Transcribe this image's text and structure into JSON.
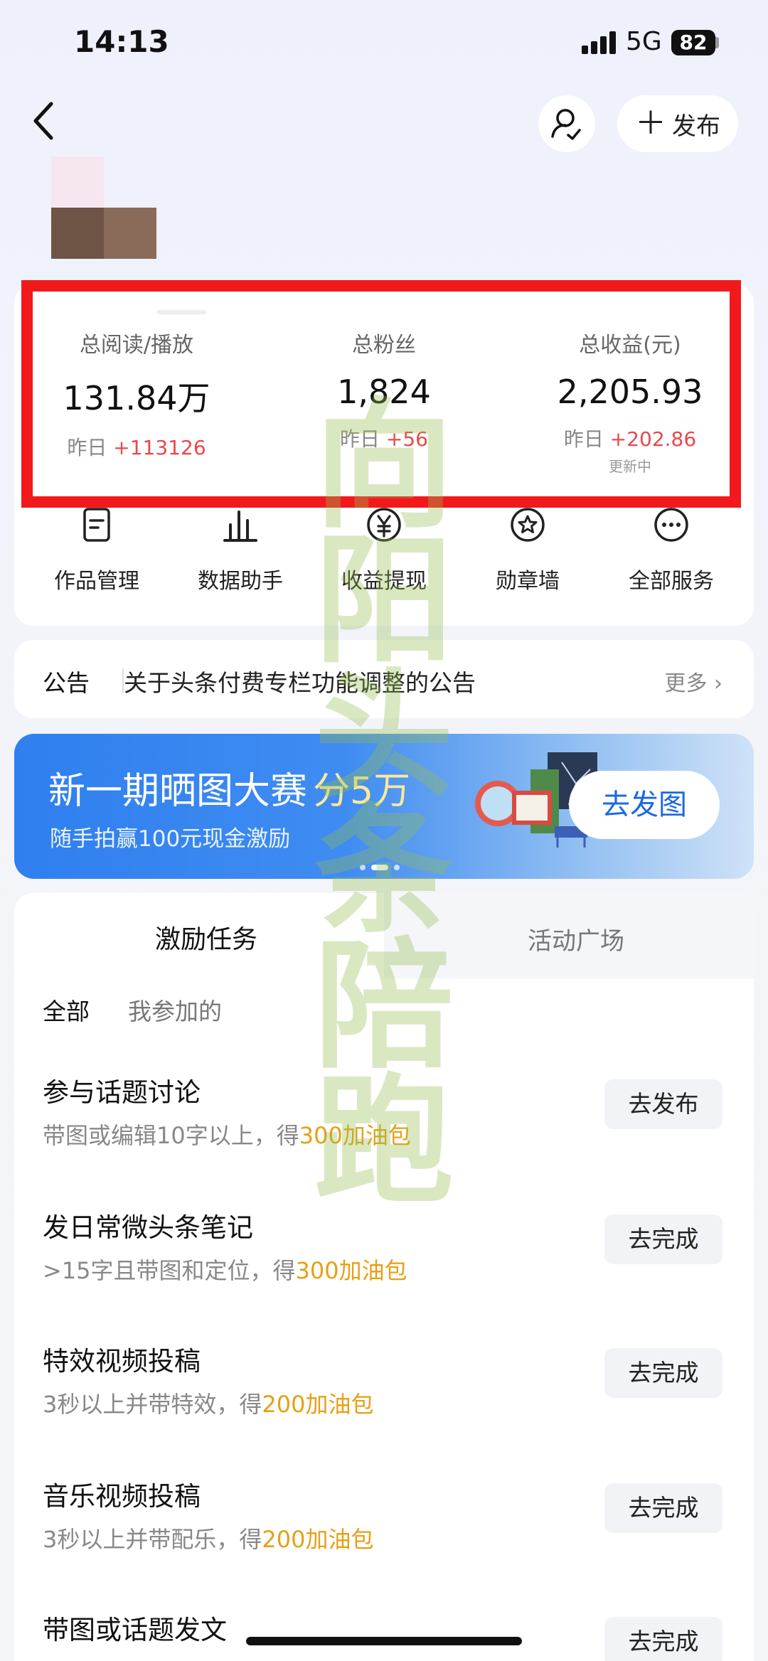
{
  "status_bar": {
    "time": "14:13",
    "network": "5G",
    "battery": "82"
  },
  "nav": {
    "publish_label": "发布"
  },
  "stats": [
    {
      "label": "总阅读/播放",
      "value": "131.84万",
      "delta_prefix": "昨日",
      "delta": "+113126",
      "sub": ""
    },
    {
      "label": "总粉丝",
      "value": "1,824",
      "delta_prefix": "昨日",
      "delta": "+56",
      "sub": ""
    },
    {
      "label": "总收益(元)",
      "value": "2,205.93",
      "delta_prefix": "昨日",
      "delta": "+202.86",
      "sub": "更新中"
    }
  ],
  "services": [
    {
      "label": "作品管理",
      "icon": "document-icon"
    },
    {
      "label": "数据助手",
      "icon": "bar-chart-icon"
    },
    {
      "label": "收益提现",
      "icon": "yen-icon"
    },
    {
      "label": "勋章墙",
      "icon": "medal-icon"
    },
    {
      "label": "全部服务",
      "icon": "more-icon"
    }
  ],
  "notice": {
    "tag": "公告",
    "title": "关于头条付费专栏功能调整的公告",
    "more": "更多 ›"
  },
  "banner": {
    "title": "新一期晒图大赛",
    "title_highlight": "分5万",
    "subtitle": "随手拍赢100元现金激励",
    "cta": "去发图"
  },
  "tasks_section": {
    "tab_active": "激励任务",
    "tab_inactive": "活动广场",
    "filter_all": "全部",
    "filter_mine": "我参加的",
    "items": [
      {
        "title": "参与话题讨论",
        "desc": "带图或编辑10字以上，得",
        "reward": "300加油包",
        "button": "去发布"
      },
      {
        "title": "发日常微头条笔记",
        "desc": ">15字且带图和定位，得",
        "reward": "300加油包",
        "button": "去完成"
      },
      {
        "title": "特效视频投稿",
        "desc": "3秒以上并带特效，得",
        "reward": "200加油包",
        "button": "去完成"
      },
      {
        "title": "音乐视频投稿",
        "desc": "3秒以上并带配乐，得",
        "reward": "200加油包",
        "button": "去完成"
      },
      {
        "title": "带图或话题发文",
        "desc": "",
        "reward": "",
        "button": "去完成"
      }
    ]
  },
  "watermark": "向阳头条陪跑",
  "colors": {
    "highlight_box": "#f2191c",
    "delta_red": "#e8484c",
    "reward_orange": "#e6a016",
    "banner_blue": "#2f7ff0",
    "cta_blue": "#1c68e0"
  }
}
